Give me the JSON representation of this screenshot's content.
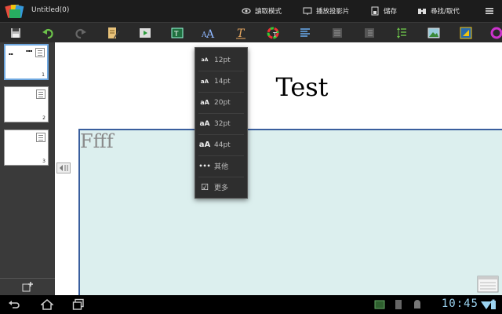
{
  "app": {
    "title": "Untitled(0)"
  },
  "actionbar": {
    "read_mode": "讀取模式",
    "play_slides": "播放投影片",
    "save": "儲存",
    "find_replace": "尋找/取代"
  },
  "toolbar": {
    "icons": [
      "save-icon",
      "undo-icon",
      "redo-icon",
      "edit-icon",
      "play-icon",
      "text-frame-icon",
      "font-size-icon",
      "text-format-icon",
      "color-icon",
      "align-icon",
      "list-icon",
      "list2-icon",
      "indent-icon",
      "image-icon",
      "shape-icon",
      "more-color-icon"
    ]
  },
  "slides": [
    {
      "number": "1",
      "selected": true
    },
    {
      "number": "2",
      "selected": false
    },
    {
      "number": "3",
      "selected": false
    }
  ],
  "slide": {
    "title": "Test",
    "body": "Ffff"
  },
  "font_menu": {
    "items": [
      {
        "icon": "aA",
        "label": "12pt"
      },
      {
        "icon": "aA",
        "label": "14pt"
      },
      {
        "icon": "aA",
        "label": "20pt"
      },
      {
        "icon": "aA",
        "label": "32pt"
      },
      {
        "icon": "aA",
        "label": "44pt"
      },
      {
        "icon": "•••",
        "label": "其他"
      },
      {
        "icon": "☑",
        "label": "更多"
      }
    ]
  },
  "status": {
    "time": "10:45"
  },
  "colors": {
    "accent": "#6fa8e0",
    "box_fill": "#dcefee",
    "box_border": "#3a5f9e",
    "clock": "#9bd3f0"
  }
}
